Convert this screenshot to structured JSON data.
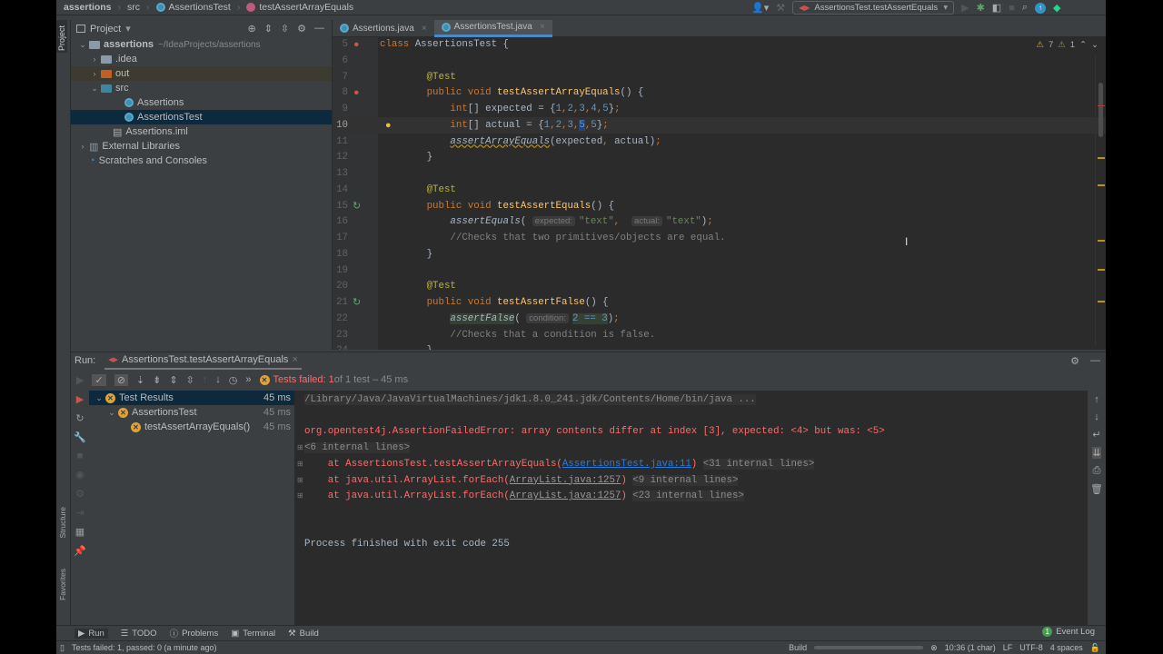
{
  "breadcrumb": [
    "assertions",
    "src",
    "AssertionsTest",
    "testAssertArrayEquals"
  ],
  "toolbar": {
    "run_config": "AssertionsTest.testAssertEquals"
  },
  "project": {
    "title": "Project",
    "side_label": "Project",
    "tree": [
      {
        "label": "assertions",
        "hint": "~/IdeaProjects/assertions",
        "indent": 0,
        "arrow": "v",
        "type": "module"
      },
      {
        "label": ".idea",
        "indent": 1,
        "arrow": ">",
        "type": "folder"
      },
      {
        "label": "out",
        "indent": 1,
        "arrow": ">",
        "type": "out"
      },
      {
        "label": "src",
        "indent": 1,
        "arrow": "v",
        "type": "src"
      },
      {
        "label": "Assertions",
        "indent": 3,
        "arrow": "",
        "type": "class"
      },
      {
        "label": "AssertionsTest",
        "indent": 3,
        "arrow": "",
        "type": "class",
        "selected": true
      },
      {
        "label": "Assertions.iml",
        "indent": 2,
        "arrow": "",
        "type": "file"
      },
      {
        "label": "External Libraries",
        "indent": 0,
        "arrow": ">",
        "type": "lib"
      },
      {
        "label": "Scratches and Consoles",
        "indent": 0,
        "arrow": "",
        "type": "scratch"
      }
    ]
  },
  "editor": {
    "tabs": [
      {
        "label": "Assertions.java",
        "active": false
      },
      {
        "label": "AssertionsTest.java",
        "active": true
      }
    ],
    "warnings": "7",
    "weak_warnings": "1",
    "lines": [
      {
        "n": "5",
        "t": [
          [
            "kw",
            "class "
          ],
          [
            "plain",
            "AssertionsTest {"
          ]
        ]
      },
      {
        "n": "6",
        "t": []
      },
      {
        "n": "7",
        "t": [
          [
            "plain",
            "        "
          ],
          [
            "ann",
            "@Test"
          ]
        ]
      },
      {
        "n": "8",
        "t": [
          [
            "plain",
            "        "
          ],
          [
            "kw",
            "public void "
          ],
          [
            "fn",
            "testAssertArrayEquals"
          ],
          [
            "plain",
            "() {"
          ]
        ]
      },
      {
        "n": "9",
        "t": [
          [
            "plain",
            "            "
          ],
          [
            "kw",
            "int"
          ],
          [
            "plain",
            "[] expected = {"
          ],
          [
            "num",
            "1"
          ],
          [
            "kw",
            ","
          ],
          [
            "num",
            "2"
          ],
          [
            "kw",
            ","
          ],
          [
            "num",
            "3"
          ],
          [
            "kw",
            ","
          ],
          [
            "num",
            "4"
          ],
          [
            "kw",
            ","
          ],
          [
            "num",
            "5"
          ],
          [
            "plain",
            "}"
          ],
          [
            "kw",
            ";"
          ]
        ]
      },
      {
        "n": "10",
        "t": [
          [
            "plain",
            "            "
          ],
          [
            "kw",
            "int"
          ],
          [
            "plain",
            "[] actual = {"
          ],
          [
            "num",
            "1"
          ],
          [
            "kw",
            ","
          ],
          [
            "num",
            "2"
          ],
          [
            "kw",
            ","
          ],
          [
            "num",
            "3"
          ],
          [
            "kw",
            ","
          ],
          [
            "selnum",
            "5"
          ],
          [
            "kw",
            ","
          ],
          [
            "num",
            "5"
          ],
          [
            "plain",
            "}"
          ],
          [
            "kw",
            ";"
          ]
        ]
      },
      {
        "n": "11",
        "t": [
          [
            "plain",
            "            "
          ],
          [
            "warn",
            "assertArrayEquals"
          ],
          [
            "plain",
            "(expected"
          ],
          [
            "kw",
            ", "
          ],
          [
            "plain",
            "actual)"
          ],
          [
            "kw",
            ";"
          ]
        ]
      },
      {
        "n": "12",
        "t": [
          [
            "plain",
            "        }"
          ]
        ]
      },
      {
        "n": "13",
        "t": []
      },
      {
        "n": "14",
        "t": [
          [
            "plain",
            "        "
          ],
          [
            "ann",
            "@Test"
          ]
        ]
      },
      {
        "n": "15",
        "t": [
          [
            "plain",
            "        "
          ],
          [
            "kw",
            "public void "
          ],
          [
            "fn",
            "testAssertEquals"
          ],
          [
            "plain",
            "() {"
          ]
        ]
      },
      {
        "n": "16",
        "t": [
          [
            "plain",
            "            "
          ],
          [
            "ital",
            "assertEquals"
          ],
          [
            "plain",
            "( "
          ],
          [
            "hint",
            "expected:"
          ],
          [
            "str",
            "\"text\""
          ],
          [
            "kw",
            ",  "
          ],
          [
            "hint",
            "actual:"
          ],
          [
            "str",
            "\"text\""
          ],
          [
            "plain",
            ")"
          ],
          [
            "kw",
            ";"
          ]
        ]
      },
      {
        "n": "17",
        "t": [
          [
            "plain",
            "            "
          ],
          [
            "cmt",
            "//Checks that two primitives/objects are equal."
          ]
        ]
      },
      {
        "n": "18",
        "t": [
          [
            "plain",
            "        }"
          ]
        ]
      },
      {
        "n": "19",
        "t": []
      },
      {
        "n": "20",
        "t": [
          [
            "plain",
            "        "
          ],
          [
            "ann",
            "@Test"
          ]
        ]
      },
      {
        "n": "21",
        "t": [
          [
            "plain",
            "        "
          ],
          [
            "kw",
            "public void "
          ],
          [
            "fn",
            "testAssertFalse"
          ],
          [
            "plain",
            "() {"
          ]
        ]
      },
      {
        "n": "22",
        "t": [
          [
            "plain",
            "            "
          ],
          [
            "hl",
            "assertFalse"
          ],
          [
            "plain",
            "( "
          ],
          [
            "hint",
            "condition:"
          ],
          [
            "hln",
            "2 == 3"
          ],
          [
            "plain",
            ")"
          ],
          [
            "kw",
            ";"
          ]
        ]
      },
      {
        "n": "23",
        "t": [
          [
            "plain",
            "            "
          ],
          [
            "cmt",
            "//Checks that a condition is false."
          ]
        ]
      },
      {
        "n": "24",
        "t": [
          [
            "plain",
            "        }"
          ]
        ]
      }
    ]
  },
  "run": {
    "label": "Run:",
    "tab": "AssertionsTest.testAssertArrayEquals",
    "status_prefix": "Tests failed: 1",
    "status_suffix": " of 1 test – 45 ms",
    "tree": [
      {
        "label": "Test Results",
        "time": "45 ms",
        "indent": 0
      },
      {
        "label": "AssertionsTest",
        "time": "45 ms",
        "indent": 1
      },
      {
        "label": "testAssertArrayEquals()",
        "time": "45 ms",
        "indent": 2
      }
    ],
    "console": [
      [
        [
          "fold",
          "/Library/Java/JavaVirtualMachines/jdk1.8.0_241.jdk/Contents/Home/bin/java ..."
        ]
      ],
      [],
      [
        [
          "err",
          "org.opentest4j.AssertionFailedError: array contents differ at index [3], expected: <4> but was: <5>"
        ]
      ],
      [
        [
          "fold",
          "<6 internal lines>"
        ]
      ],
      [
        [
          "err",
          "    at AssertionsTest.testAssertArrayEquals("
        ],
        [
          "link",
          "AssertionsTest.java:11"
        ],
        [
          "err",
          ")"
        ],
        [
          "plain",
          " "
        ],
        [
          "fold",
          "<31 internal lines>"
        ]
      ],
      [
        [
          "err",
          "    at java.util.ArrayList.forEach("
        ],
        [
          "ulink",
          "ArrayList.java:1257"
        ],
        [
          "err",
          ")"
        ],
        [
          "plain",
          " "
        ],
        [
          "fold",
          "<9 internal lines>"
        ]
      ],
      [
        [
          "err",
          "    at java.util.ArrayList.forEach("
        ],
        [
          "ulink",
          "ArrayList.java:1257"
        ],
        [
          "err",
          ")"
        ],
        [
          "plain",
          " "
        ],
        [
          "fold",
          "<23 internal lines>"
        ]
      ],
      [],
      [],
      [
        [
          "plain",
          "Process finished with exit code 255"
        ]
      ]
    ]
  },
  "bottom_tabs": [
    "Run",
    "TODO",
    "Problems",
    "Terminal",
    "Build"
  ],
  "event_log": "Event Log",
  "event_count": "1",
  "status": {
    "message": "Tests failed: 1, passed: 0 (a minute ago)",
    "build": "Build",
    "position": "10:36 (1 char)",
    "line_sep": "LF",
    "encoding": "UTF-8",
    "indent": "4 spaces"
  },
  "side": {
    "structure": "Structure",
    "favorites": "Favorites"
  }
}
